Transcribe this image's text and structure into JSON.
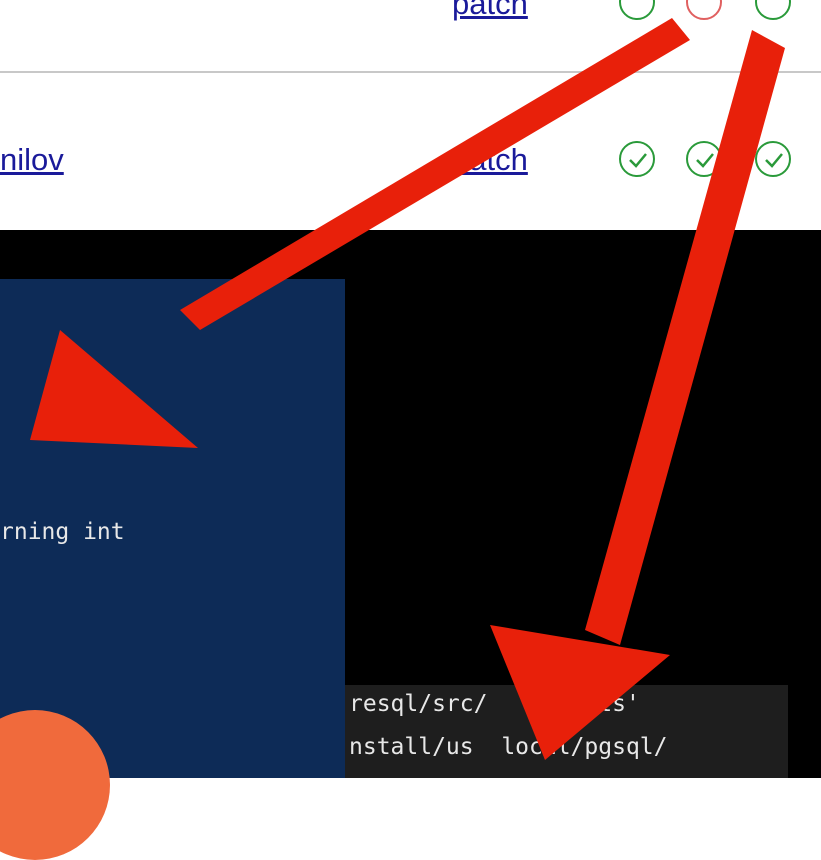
{
  "rows": [
    {
      "author": "",
      "link": "patch",
      "statuses": [
        "pass",
        "fail",
        "pass"
      ]
    },
    {
      "author": "nilov",
      "link": "patch",
      "statuses": [
        "pass",
        "pass",
        "pass"
      ]
    }
  ],
  "code_panel": {
    "line": "rning int"
  },
  "terminal": {
    "lines": [
      "resql/src/   scripts'",
      "nstall/us  local/pgsql/"
    ]
  },
  "colors": {
    "link": "#1a1a9a",
    "pass": "#2a9a3a",
    "fail": "#e06060",
    "annotation": "#e8200a",
    "panel": "#0d2b57"
  }
}
